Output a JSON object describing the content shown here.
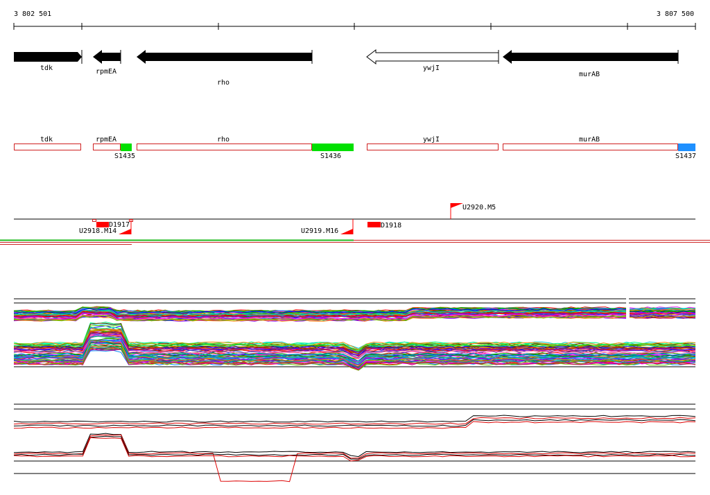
{
  "coordinates": {
    "start": "3 802 501",
    "end": "3 807 500"
  },
  "genes": [
    {
      "name": "tdk",
      "strand": "+",
      "fill": "black"
    },
    {
      "name": "rpmEA",
      "strand": "-",
      "fill": "black"
    },
    {
      "name": "rho",
      "strand": "-",
      "fill": "black"
    },
    {
      "name": "ywjI",
      "strand": "-",
      "fill": "white"
    },
    {
      "name": "murAB",
      "strand": "-",
      "fill": "black"
    }
  ],
  "transcripts": [
    {
      "gene": "tdk"
    },
    {
      "gene": "rpmEA"
    },
    {
      "gene": "rho"
    },
    {
      "gene": "ywjI"
    },
    {
      "gene": "murAB"
    }
  ],
  "segments": [
    {
      "name": "S1435",
      "color": "#00e000"
    },
    {
      "name": "S1436",
      "color": "#00e000"
    },
    {
      "name": "S1437",
      "color": "#1e90ff"
    }
  ],
  "features": [
    {
      "name": "U2918.M14"
    },
    {
      "name": "D1917"
    },
    {
      "name": "U2919.M16"
    },
    {
      "name": "D1918"
    },
    {
      "name": "U2920.M5"
    }
  ],
  "colors": {
    "transcript_outline": "#d02020",
    "feature_red": "#ff0000",
    "divider_green": "#22bb22",
    "divider_red": "#cc2222",
    "trace_black": "#000000",
    "trace_red": "#dd0000"
  }
}
